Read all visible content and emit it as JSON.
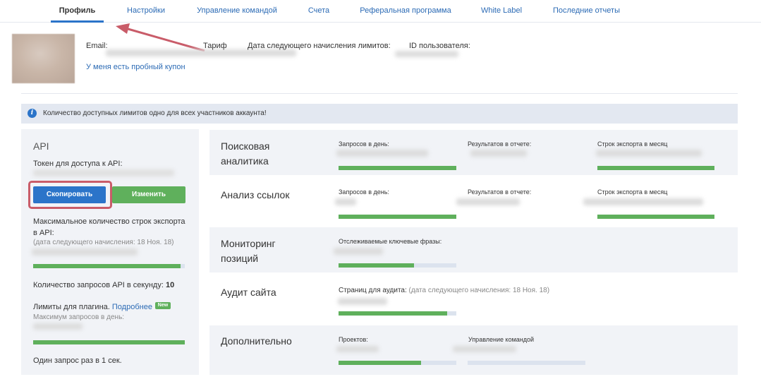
{
  "tabs": [
    {
      "label": "Профиль",
      "active": true
    },
    {
      "label": "Настройки"
    },
    {
      "label": "Управление командой"
    },
    {
      "label": "Счета"
    },
    {
      "label": "Реферальная программа"
    },
    {
      "label": "White Label"
    },
    {
      "label": "Последние отчеты"
    }
  ],
  "profile": {
    "email_label": "Email:",
    "tariff_label": "Тариф",
    "next_limits_label": "Дата следующего начисления лимитов:",
    "user_id_label": "ID пользователя:",
    "coupon_link": "У меня есть пробный купон"
  },
  "info": {
    "icon": "info-icon",
    "text": "Количество доступных лимитов одно для всех участников аккаунта!"
  },
  "api": {
    "title": "API",
    "token_label": "Токен для доступа к API:",
    "copy_button": "Скопировать",
    "change_button": "Изменить",
    "max_rows_label": "Максимальное количество строк экспорта в API:",
    "next_charge_note": "(дата следующего начисления: 18 Ноя. 18)",
    "max_rows_progress": 0.97,
    "rps_label": "Количество запросов API в секунду:",
    "rps_value": "10",
    "plugin_limits_label": "Лимиты для плагина.",
    "plugin_more_link": "Подробнее",
    "new_badge": "New",
    "max_requests_day_label": "Максимум запросов в день:",
    "plugin_progress": 1.0,
    "one_request_note": "Один запрос раз в 1 сек."
  },
  "sections": {
    "search": {
      "title": "Поисковая аналитика",
      "col1": "Запросов в день:",
      "col2": "Результатов в отчете:",
      "col3": "Строк экспорта в месяц",
      "progress1": 1.0,
      "progress3": 1.0
    },
    "links": {
      "title": "Анализ ссылок",
      "col1": "Запросов в день:",
      "col2": "Результатов в отчете:",
      "col3": "Строк экспорта в месяц",
      "progress1": 1.0,
      "progress3": 1.0
    },
    "monitoring": {
      "title": "Мониторинг позиций",
      "col1": "Отслеживаемые ключевые фразы:",
      "progress1": 0.64
    },
    "audit": {
      "title": "Аудит сайта",
      "col1": "Страниц для аудита:",
      "col1_note": "(дата следующего начисления: 18 Ноя. 18)",
      "progress1": 0.92
    },
    "extra": {
      "title": "Дополнительно",
      "col1": "Проектов:",
      "col2": "Управление командой",
      "progress1": 0.7,
      "progress2": 0.0
    }
  },
  "colors": {
    "accent": "#2b74c9",
    "green": "#5fb05c",
    "highlight": "#c95c69",
    "arrow": "#c95c69"
  }
}
